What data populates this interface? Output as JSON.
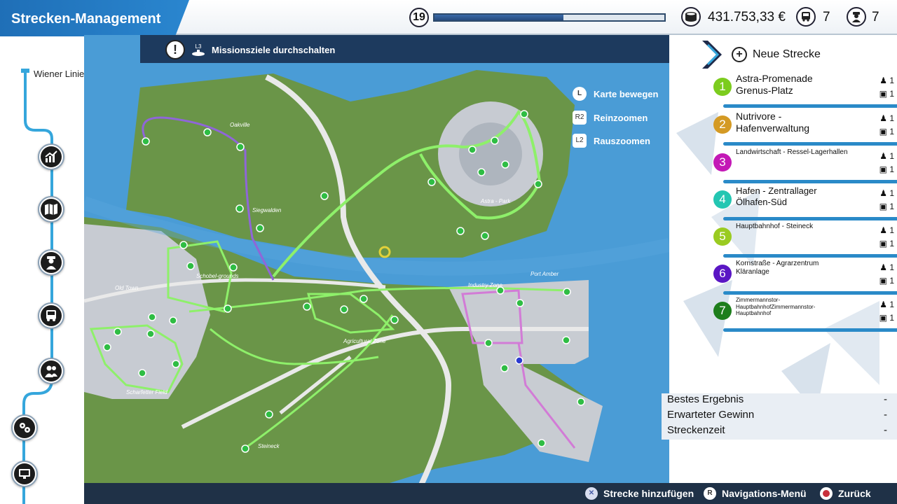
{
  "header": {
    "title": "Strecken-Management",
    "level": "19",
    "progress_fraction": 0.56,
    "money": "431.753,33 €",
    "buses": "7",
    "drivers": "7"
  },
  "sidebar": {
    "company": "Wiener Linien GmbH",
    "items": [
      {
        "name": "statistics-icon"
      },
      {
        "name": "map-icon"
      },
      {
        "name": "driver-icon"
      },
      {
        "name": "bus-icon"
      },
      {
        "name": "people-icon"
      },
      {
        "name": "settings-icon"
      },
      {
        "name": "monitor-icon"
      }
    ]
  },
  "map": {
    "mission_toggle_key": "L3",
    "mission_toggle_label": "Missionsziele durchschalten",
    "controls": [
      {
        "key": "L",
        "label": "Karte bewegen"
      },
      {
        "key": "R2",
        "label": "Reinzoomen"
      },
      {
        "key": "L2",
        "label": "Rauszoomen"
      }
    ],
    "districts": [
      "Oakville",
      "Siegwalden",
      "Astra - Park",
      "Old Town",
      "Schobel-grounds",
      "Industry Zone",
      "Port Amber",
      "Agricultural Zone",
      "Scharfetter Field",
      "Steineck"
    ]
  },
  "routes_panel": {
    "new_route_label": "Neue Strecke",
    "routes": [
      {
        "num": "1",
        "name": "Astra-Promenade Grenus-Platz",
        "drivers": "1",
        "buses": "1",
        "color": "#7ccc1e",
        "size": "14px"
      },
      {
        "num": "2",
        "name": "Nutrivore - Hafenverwaltung",
        "drivers": "1",
        "buses": "1",
        "color": "#d49a24",
        "size": "14px"
      },
      {
        "num": "3",
        "name": "Landwirtschaft - Ressel-Lagerhallen",
        "drivers": "1",
        "buses": "1",
        "color": "#c319b6",
        "size": "10px"
      },
      {
        "num": "4",
        "name": "Hafen - Zentrallager Ölhafen-Süd",
        "drivers": "1",
        "buses": "1",
        "color": "#23c6b2",
        "size": "13px"
      },
      {
        "num": "5",
        "name": "Hauptbahnhof - Steineck",
        "drivers": "1",
        "buses": "1",
        "color": "#9acb21",
        "size": "10px"
      },
      {
        "num": "6",
        "name": "Kornstraße - Agrarzentrum Kläranlage",
        "drivers": "1",
        "buses": "1",
        "color": "#5a16c4",
        "size": "10px"
      },
      {
        "num": "7",
        "name": "Zimmermannstor-HauptbahnhofZimmermannstor-Hauptbahnhof",
        "drivers": "1",
        "buses": "1",
        "color": "#1d7e1c",
        "size": "8px"
      }
    ]
  },
  "results": {
    "best_label": "Bestes Ergebnis",
    "best_value": "-",
    "profit_label": "Erwarteter Gewinn",
    "profit_value": "-",
    "time_label": "Streckenzeit",
    "time_value": "-"
  },
  "bottom": {
    "add_label": "Strecke hinzufügen",
    "nav_key": "R",
    "nav_label": "Navigations-Menü",
    "back_label": "Zurück"
  },
  "colors": {
    "accent": "#2a86cf",
    "water": "#4a9cd6",
    "land": "#6e9a4a",
    "route_green": "#8ef06a"
  }
}
